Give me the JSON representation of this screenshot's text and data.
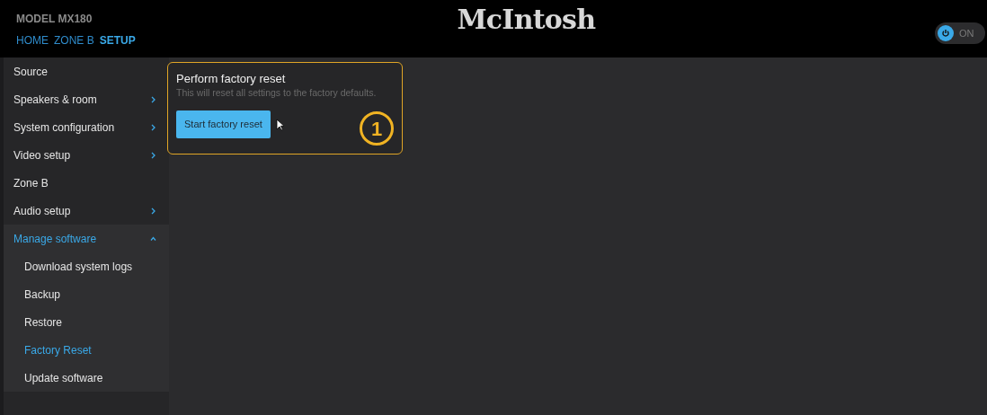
{
  "header": {
    "model": "MODEL MX180",
    "logo": "McIntosh",
    "nav": [
      {
        "label": "HOME",
        "selected": false
      },
      {
        "label": "ZONE B",
        "selected": false
      },
      {
        "label": "SETUP",
        "selected": true
      }
    ],
    "power": {
      "label": "ON",
      "on": true
    }
  },
  "sidebar": {
    "items": [
      {
        "label": "Source"
      },
      {
        "label": "Speakers & room",
        "expanded": false
      },
      {
        "label": "System configuration",
        "expanded": false
      },
      {
        "label": "Video setup",
        "expanded": false
      },
      {
        "label": "Zone B"
      },
      {
        "label": "Audio setup",
        "expanded": false
      },
      {
        "label": "Manage software",
        "expanded": true,
        "children": [
          {
            "label": "Download system logs",
            "selected": false
          },
          {
            "label": "Backup",
            "selected": false
          },
          {
            "label": "Restore",
            "selected": false
          },
          {
            "label": "Factory Reset",
            "selected": true
          },
          {
            "label": "Update software",
            "selected": false
          }
        ]
      }
    ]
  },
  "card": {
    "title": "Perform factory reset",
    "description": "This will reset all settings to the factory defaults.",
    "button": "Start factory reset",
    "callout": "1"
  }
}
